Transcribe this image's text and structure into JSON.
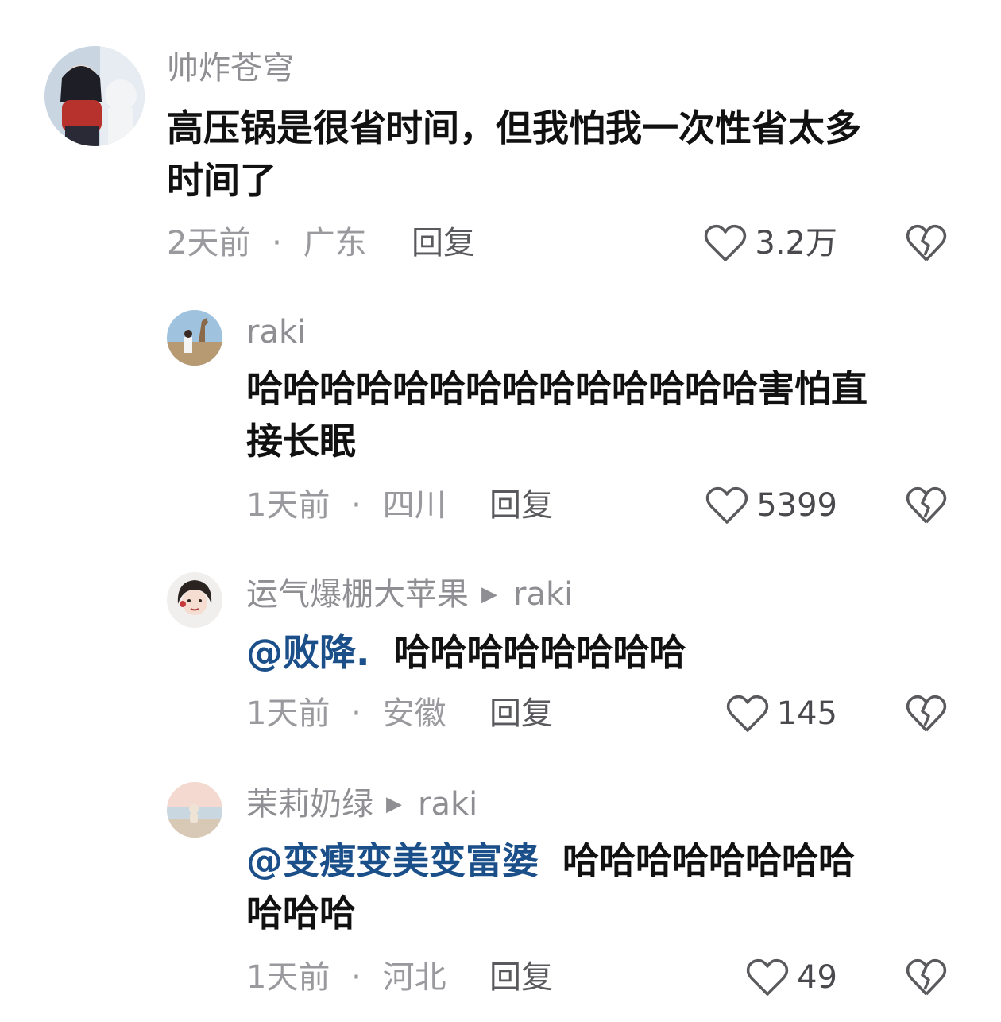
{
  "comments": [
    {
      "username": "帅炸苍穹",
      "reply_to": "",
      "mention": "",
      "text_line1": "高压锅是很省时间，但我怕我一次性省太多",
      "text_line2": "时间了",
      "time": "2天前",
      "location": "广东",
      "reply_label": "回复",
      "likes": "3.2万"
    },
    {
      "username": "raki",
      "reply_to": "",
      "mention": "",
      "text_line1": "哈哈哈哈哈哈哈哈哈哈哈哈哈哈害怕直",
      "text_line2": "接长眠",
      "time": "1天前",
      "location": "四川",
      "reply_label": "回复",
      "likes": "5399"
    },
    {
      "username": "运气爆棚大苹果",
      "reply_to": "raki",
      "mention": "@败降.",
      "text_line1": "哈哈哈哈哈哈哈哈",
      "text_line2": "",
      "time": "1天前",
      "location": "安徽",
      "reply_label": "回复",
      "likes": "145"
    },
    {
      "username": "茉莉奶绿",
      "reply_to": "raki",
      "mention": "@变瘦变美变富婆",
      "text_line1": "哈哈哈哈哈哈哈哈",
      "text_line2": "哈哈哈",
      "time": "1天前",
      "location": "河北",
      "reply_label": "回复",
      "likes": "49"
    }
  ],
  "separator": "·",
  "icons": {
    "like": "heart-outline-icon",
    "dislike": "broken-heart-icon",
    "reply_arrow": "triangle-right-icon"
  },
  "colors": {
    "mention": "#1a4f8a",
    "meta": "#9a9a9e",
    "text": "#111111"
  }
}
